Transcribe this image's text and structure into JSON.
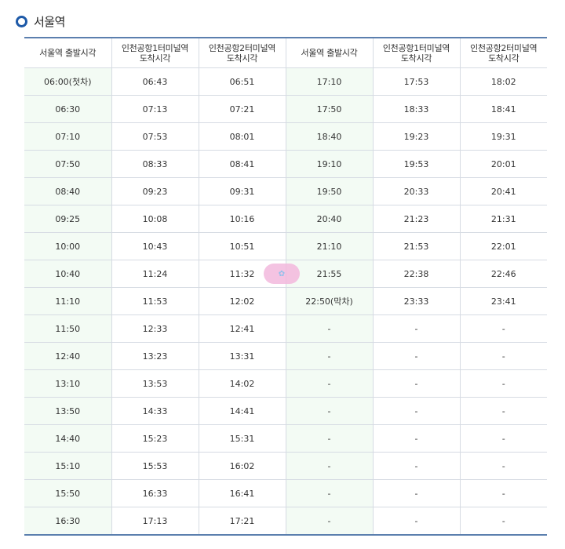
{
  "section": {
    "title": "서울역"
  },
  "table": {
    "headers": [
      "서울역 출발시각",
      "인천공항1터미널역\n도착시각",
      "인천공항2터미널역\n도착시각",
      "서울역 출발시각",
      "인천공항1터미널역\n도착시각",
      "인천공항2터미널역\n도착시각"
    ],
    "rows": [
      [
        "06:00(첫차)",
        "06:43",
        "06:51",
        "17:10",
        "17:53",
        "18:02"
      ],
      [
        "06:30",
        "07:13",
        "07:21",
        "17:50",
        "18:33",
        "18:41"
      ],
      [
        "07:10",
        "07:53",
        "08:01",
        "18:40",
        "19:23",
        "19:31"
      ],
      [
        "07:50",
        "08:33",
        "08:41",
        "19:10",
        "19:53",
        "20:01"
      ],
      [
        "08:40",
        "09:23",
        "09:31",
        "19:50",
        "20:33",
        "20:41"
      ],
      [
        "09:25",
        "10:08",
        "10:16",
        "20:40",
        "21:23",
        "21:31"
      ],
      [
        "10:00",
        "10:43",
        "10:51",
        "21:10",
        "21:53",
        "22:01"
      ],
      [
        "10:40",
        "11:24",
        "11:32",
        "21:55",
        "22:38",
        "22:46"
      ],
      [
        "11:10",
        "11:53",
        "12:02",
        "22:50(막차)",
        "23:33",
        "23:41"
      ],
      [
        "11:50",
        "12:33",
        "12:41",
        "-",
        "-",
        "-"
      ],
      [
        "12:40",
        "13:23",
        "13:31",
        "-",
        "-",
        "-"
      ],
      [
        "13:10",
        "13:53",
        "14:02",
        "-",
        "-",
        "-"
      ],
      [
        "13:50",
        "14:33",
        "14:41",
        "-",
        "-",
        "-"
      ],
      [
        "14:40",
        "15:23",
        "15:31",
        "-",
        "-",
        "-"
      ],
      [
        "15:10",
        "15:53",
        "16:02",
        "-",
        "-",
        "-"
      ],
      [
        "15:50",
        "16:33",
        "16:41",
        "-",
        "-",
        "-"
      ],
      [
        "16:30",
        "17:13",
        "17:21",
        "-",
        "-",
        "-"
      ]
    ]
  },
  "colors": {
    "accent": "#1e5aa8",
    "header_border": "#5b7fae",
    "departure_cell_bg": "#f3fbf4"
  },
  "icons": {
    "section_bullet": "circle-bullet-icon"
  }
}
